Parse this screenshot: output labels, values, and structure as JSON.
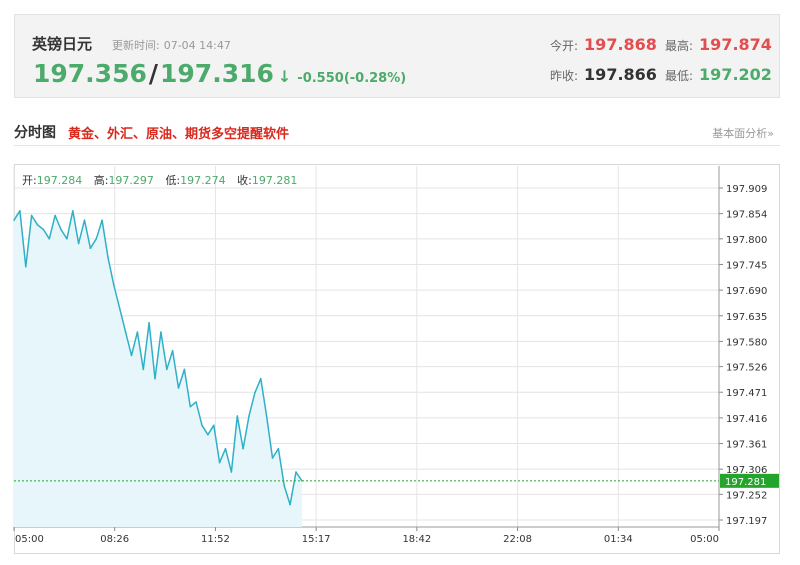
{
  "quote": {
    "name": "英镑日元",
    "update_label": "更新时间:",
    "update_time": "07-04 14:47",
    "bid": "197.356",
    "separator": "/",
    "ask": "197.316",
    "arrow": "↓",
    "change": "-0.550(-0.28%)",
    "open_label": "今开:",
    "open_value": "197.868",
    "high_label": "最高:",
    "high_value": "197.874",
    "prev_close_label": "昨收:",
    "prev_close_value": "197.866",
    "low_label": "最低:",
    "low_value": "197.202"
  },
  "section": {
    "title": "分时图",
    "ad_text": "黄金、外汇、原油、期货多空提醒软件",
    "link": "基本面分析»"
  },
  "ohlc": {
    "open_label": "开:",
    "open": "197.284",
    "high_label": "高:",
    "high": "197.297",
    "low_label": "低:",
    "low": "197.274",
    "close_label": "收:",
    "close": "197.281"
  },
  "colors": {
    "line": "#2fb0c8",
    "area": "#e6f6fa",
    "current": "#23a52c",
    "grid": "#e4e4e4",
    "red": "#e24e4e",
    "green": "#4caa6b"
  },
  "chart_data": {
    "type": "area",
    "x_ticks": [
      "05:00",
      "08:26",
      "11:52",
      "15:17",
      "18:42",
      "22:08",
      "01:34",
      "05:00"
    ],
    "y_ticks": [
      "197.909",
      "197.854",
      "197.800",
      "197.745",
      "197.690",
      "197.635",
      "197.580",
      "197.526",
      "197.471",
      "197.416",
      "197.361",
      "197.306",
      "197.252",
      "197.197"
    ],
    "ylim": [
      197.197,
      197.909
    ],
    "current_value": "197.281",
    "series": [
      {
        "x": [
          "05:00",
          "05:12",
          "05:24",
          "05:36",
          "05:48",
          "06:00",
          "06:12",
          "06:24",
          "06:36",
          "06:48",
          "07:00",
          "07:12",
          "07:24",
          "07:36",
          "07:48",
          "08:00",
          "08:12",
          "08:24",
          "08:36",
          "08:48",
          "09:00",
          "09:12",
          "09:24",
          "09:36",
          "09:48",
          "10:00",
          "10:12",
          "10:24",
          "10:36",
          "10:48",
          "11:00",
          "11:12",
          "11:24",
          "11:36",
          "11:48",
          "12:00",
          "12:12",
          "12:24",
          "12:36",
          "12:48",
          "13:00",
          "13:12",
          "13:24",
          "13:36",
          "13:48",
          "14:00",
          "14:12",
          "14:24",
          "14:36",
          "14:48"
        ],
        "values": [
          197.84,
          197.86,
          197.74,
          197.85,
          197.83,
          197.82,
          197.8,
          197.85,
          197.82,
          197.8,
          197.86,
          197.79,
          197.84,
          197.78,
          197.8,
          197.84,
          197.76,
          197.7,
          197.65,
          197.6,
          197.55,
          197.6,
          197.52,
          197.62,
          197.5,
          197.6,
          197.52,
          197.56,
          197.48,
          197.52,
          197.44,
          197.45,
          197.4,
          197.38,
          197.4,
          197.32,
          197.35,
          197.3,
          197.42,
          197.35,
          197.42,
          197.47,
          197.5,
          197.42,
          197.33,
          197.35,
          197.27,
          197.23,
          197.3,
          197.281
        ]
      }
    ]
  }
}
